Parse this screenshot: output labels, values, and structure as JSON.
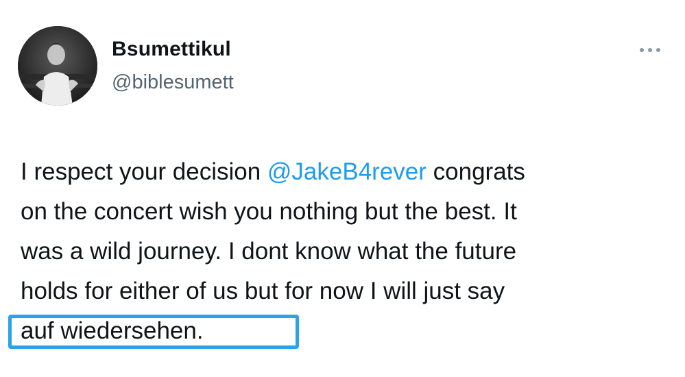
{
  "author": {
    "display_name": "Bsumettikul",
    "handle": "@biblesumett",
    "avatar_icon": "profile-photo"
  },
  "menu": {
    "more_icon": "more-horizontal-icon"
  },
  "tweet": {
    "line1_pre": "I respect your decision ",
    "line1_mention": "@JakeB4rever",
    "line1_post": " congrats",
    "line2": "on the concert wish you nothing but the best. It",
    "line3": "was a wild journey. I dont know what the future",
    "line4": "holds for either of us but for now I will just say",
    "line5": "auf wiedersehen."
  },
  "colors": {
    "mention": "#1d9bf0",
    "highlight": "#2aa4e8",
    "secondary_text": "#536471"
  }
}
